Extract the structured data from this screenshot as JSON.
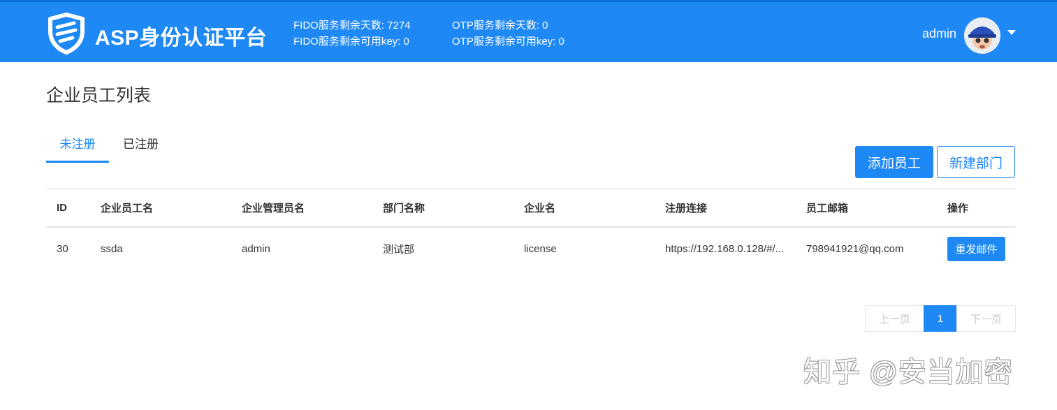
{
  "header": {
    "brand": "ASP身份认证平台",
    "stats": {
      "fido_days": "FIDO服务剩余天数: 7274",
      "fido_keys": "FIDO服务剩余可用key: 0",
      "otp_days": "OTP服务剩余天数: 0",
      "otp_keys": "OTP服务剩余可用key: 0"
    },
    "user": "admin",
    "colors": {
      "bar": "#1e88f5",
      "accent": "#1e88f5"
    }
  },
  "main": {
    "title": "企业员工列表",
    "tabs": [
      {
        "label": "未注册",
        "active": true
      },
      {
        "label": "已注册",
        "active": false
      }
    ],
    "actions": {
      "add_employee": "添加员工",
      "new_department": "新建部门"
    },
    "table": {
      "headers": [
        "ID",
        "企业员工名",
        "企业管理员名",
        "部门名称",
        "企业名",
        "注册连接",
        "员工邮箱",
        "操作"
      ],
      "rows": [
        {
          "id": "30",
          "employee": "ssda",
          "admin": "admin",
          "department": "测试部",
          "company": "license",
          "link": "https://192.168.0.128/#/...",
          "email": "798941921@qq.com",
          "action": "重发邮件"
        }
      ]
    },
    "pagination": {
      "prev": "上一页",
      "current": "1",
      "next": "下一页"
    }
  },
  "watermark": "知乎 @安当加密"
}
